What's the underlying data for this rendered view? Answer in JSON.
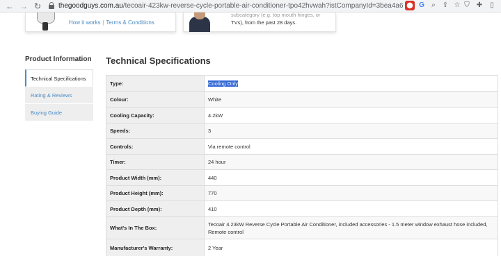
{
  "browser": {
    "url_host": "thegoodguys.com.au",
    "url_path": "/tecoair-423kw-reverse-cycle-portable-air-conditioner-tpo42hvwah?istCompanyId=3bea4a6c-bec2-47..."
  },
  "top_cards": {
    "left_links": [
      "How it works",
      "Terms & Conditions"
    ],
    "right_text_faded": "subcategory (e.g. top mouth hinges, or",
    "right_text": "TVs), from the past 28 days."
  },
  "sidebar": {
    "title": "Product Information",
    "items": [
      {
        "label": "Technical Specifications",
        "active": true
      },
      {
        "label": "Rating & Reviews",
        "active": false
      },
      {
        "label": "Buying Guide",
        "active": false
      }
    ]
  },
  "main": {
    "title": "Technical Specifications",
    "rows": [
      {
        "label": "Type:",
        "value": "Cooling Only"
      },
      {
        "label": "Colour:",
        "value": "White"
      },
      {
        "label": "Cooling Capacity:",
        "value": "4.2kW"
      },
      {
        "label": "Speeds:",
        "value": "3"
      },
      {
        "label": "Controls:",
        "value": "Via remote control"
      },
      {
        "label": "Timer:",
        "value": "24 hour"
      },
      {
        "label": "Product Width (mm):",
        "value": "440"
      },
      {
        "label": "Product Height (mm):",
        "value": "770"
      },
      {
        "label": "Product Depth (mm):",
        "value": "410"
      },
      {
        "label": "What's In The Box:",
        "value": "Tecoair 4.23kW Reverse Cycle Portable Air Conditioner, included accessories - 1.5 meter window exhaust hose included, Remote control"
      },
      {
        "label": "Manufacturer's Warranty:",
        "value": "2 Year"
      }
    ]
  },
  "colors": {
    "link": "#4a8cc4",
    "selection": "#3367d6",
    "label_bg": "#efefef"
  }
}
